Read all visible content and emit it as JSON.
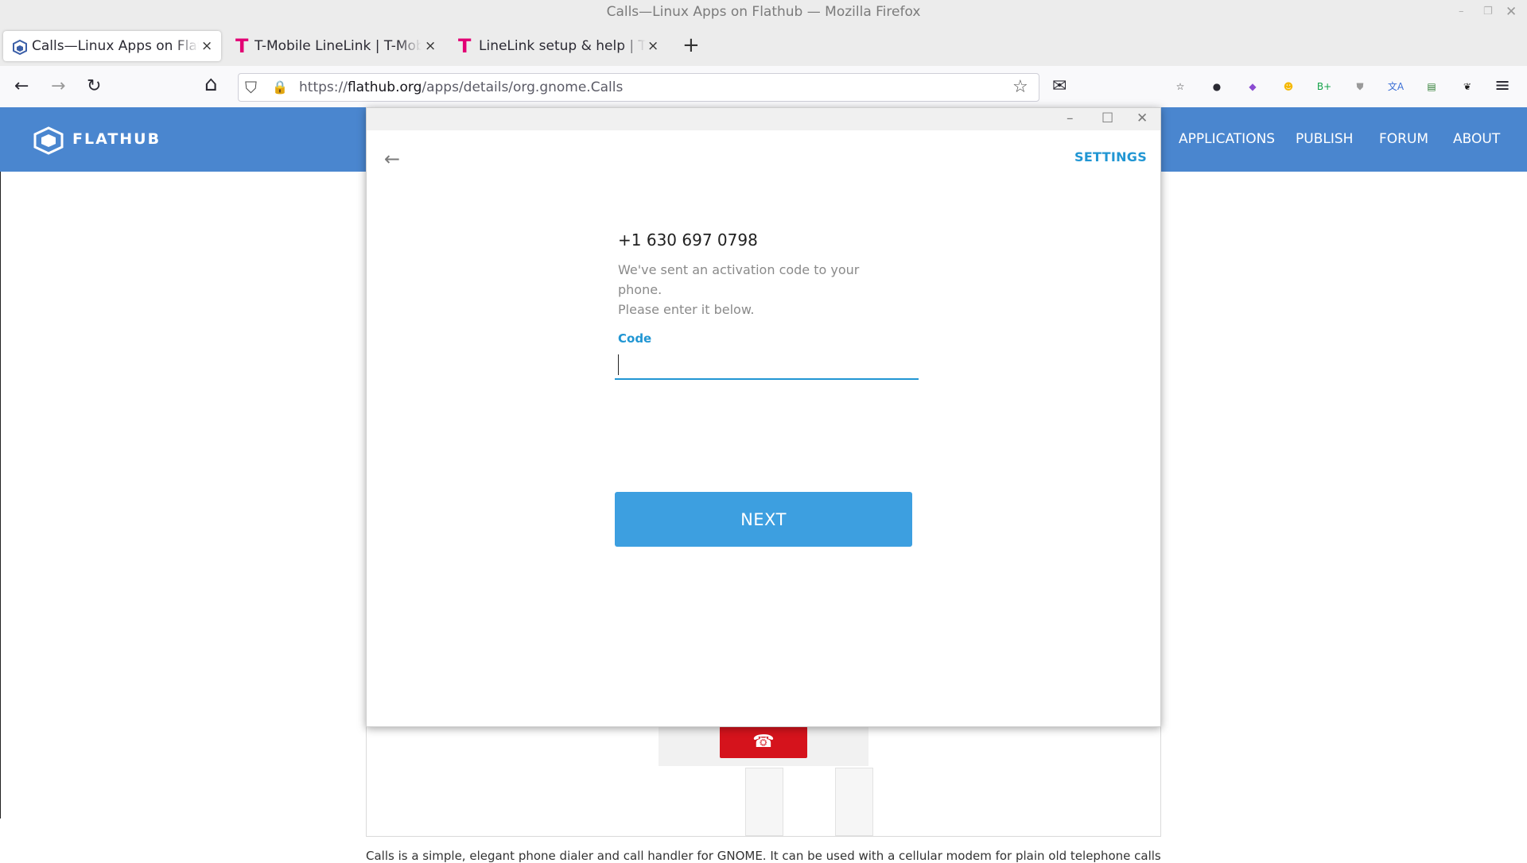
{
  "window": {
    "title": "Calls—Linux Apps on Flathub — Mozilla Firefox",
    "minimize_glyph": "–",
    "restore_glyph": "❐",
    "close_glyph": "✕"
  },
  "tabs": [
    {
      "title": "Calls—Linux Apps on Flathub",
      "active": true,
      "favicon": "flathub-icon"
    },
    {
      "title": "T-Mobile LineLink | T-Mobile",
      "active": false,
      "favicon": "tmobile-icon"
    },
    {
      "title": "LineLink setup & help | T-Mobile",
      "active": false,
      "favicon": "tmobile-icon"
    }
  ],
  "tab_close_glyph": "×",
  "new_tab_glyph": "+",
  "tmobile_glyph": "T",
  "toolbar": {
    "back_glyph": "←",
    "forward_glyph": "→",
    "reload_glyph": "↻",
    "home_glyph": "⌂",
    "menu_glyph": "≡",
    "bookmark_glyph": "☆",
    "mail_glyph": "✉"
  },
  "urlbar": {
    "prefix": "https://",
    "domain": "flathub.org",
    "path": "/apps/details/org.gnome.Calls",
    "shield_glyph": "⛉",
    "lock_glyph": "🔒"
  },
  "extensions": [
    {
      "name": "collections-icon",
      "glyph": "☆",
      "color": "#333333"
    },
    {
      "name": "dark-reader-icon",
      "glyph": "●",
      "color": "#2b2a33"
    },
    {
      "name": "cube-extension-icon",
      "glyph": "◆",
      "color": "#8a4bd1"
    },
    {
      "name": "emoji-extension-icon",
      "glyph": "☻",
      "color": "#f5b800"
    },
    {
      "name": "grammar-extension-icon",
      "glyph": "B+",
      "color": "#15a34a"
    },
    {
      "name": "shield-extension-icon",
      "glyph": "⛊",
      "color": "#9a9a9a"
    },
    {
      "name": "translate-extension-icon",
      "glyph": "文A",
      "color": "#3b6fd6"
    },
    {
      "name": "printer-extension-icon",
      "glyph": "▤",
      "color": "#2e7d32"
    },
    {
      "name": "gnome-extension-icon",
      "glyph": "❦",
      "color": "#1a1a1a"
    }
  ],
  "flathub": {
    "brand": "FLATHUB",
    "nav": [
      "APPLICATIONS",
      "PUBLISH",
      "FORUM",
      "ABOUT"
    ],
    "header_color": "#4a86cf",
    "hangup_glyph": "☎",
    "cutoff_text": "Calls is a simple, elegant phone dialer and call handler for GNOME. It can be used with a cellular modem for plain old telephone calls"
  },
  "dialog": {
    "minimize_glyph": "–",
    "maximize_glyph": "☐",
    "close_glyph": "✕",
    "back_glyph": "←",
    "settings_label": "SETTINGS",
    "phone_number": "+1 630 697 0798",
    "message_line1": "We've sent an activation code to your phone.",
    "message_line2": "Please enter it below.",
    "code_label": "Code",
    "code_value": "",
    "next_label": "NEXT",
    "accent_color": "#2196d3",
    "button_color": "#3d9fe0"
  }
}
